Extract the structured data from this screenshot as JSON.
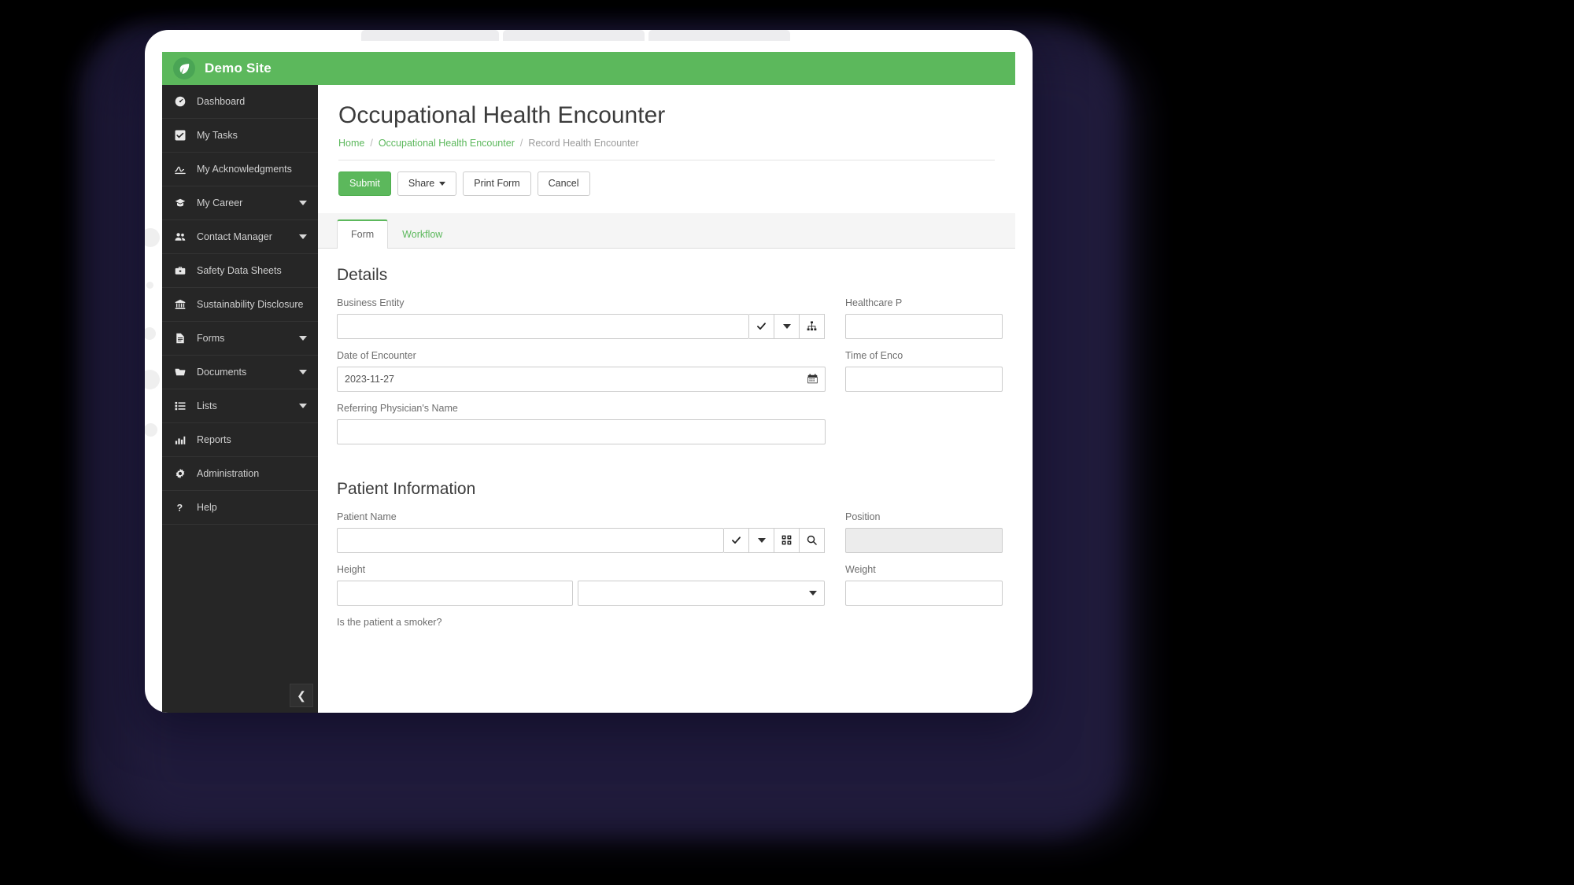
{
  "app": {
    "brand_title": "Demo Site",
    "logo_icon": "leaf-icon"
  },
  "sidebar": {
    "collapse_icon": "chevron-left-icon",
    "items": [
      {
        "label": "Dashboard",
        "icon": "dashboard-icon",
        "has_caret": false
      },
      {
        "label": "My Tasks",
        "icon": "check-square-icon",
        "has_caret": false
      },
      {
        "label": "My Acknowledgments",
        "icon": "signature-icon",
        "has_caret": false
      },
      {
        "label": "My Career",
        "icon": "graduation-icon",
        "has_caret": true
      },
      {
        "label": "Contact Manager",
        "icon": "users-icon",
        "has_caret": true
      },
      {
        "label": "Safety Data Sheets",
        "icon": "briefcase-icon",
        "has_caret": false
      },
      {
        "label": "Sustainability Disclosure",
        "icon": "bank-icon",
        "has_caret": false
      },
      {
        "label": "Forms",
        "icon": "file-icon",
        "has_caret": true
      },
      {
        "label": "Documents",
        "icon": "folder-icon",
        "has_caret": true
      },
      {
        "label": "Lists",
        "icon": "list-icon",
        "has_caret": true
      },
      {
        "label": "Reports",
        "icon": "chart-icon",
        "has_caret": false
      },
      {
        "label": "Administration",
        "icon": "gear-icon",
        "has_caret": false
      },
      {
        "label": "Help",
        "icon": "question-icon",
        "has_caret": false
      }
    ]
  },
  "header": {
    "page_title": "Occupational Health Encounter",
    "breadcrumb": {
      "home": "Home",
      "level2": "Occupational Health Encounter",
      "current": "Record Health Encounter",
      "separator": "/"
    }
  },
  "toolbar": {
    "submit_label": "Submit",
    "share_label": "Share",
    "print_label": "Print Form",
    "cancel_label": "Cancel"
  },
  "tabs": [
    {
      "label": "Form",
      "active": true
    },
    {
      "label": "Workflow",
      "active": false
    }
  ],
  "sections": {
    "details": {
      "title": "Details",
      "business_entity": {
        "label": "Business Entity",
        "value": "",
        "buttons": [
          "check-icon",
          "caret-down-icon",
          "sitemap-icon"
        ]
      },
      "healthcare_provider": {
        "label": "Healthcare P",
        "value": ""
      },
      "date_of_encounter": {
        "label": "Date of Encounter",
        "value": "2023-11-27",
        "icon": "calendar-icon"
      },
      "time_of_encounter": {
        "label": "Time of Enco",
        "value": ""
      },
      "referring_physician": {
        "label": "Referring Physician's Name",
        "value": ""
      }
    },
    "patient": {
      "title": "Patient Information",
      "patient_name": {
        "label": "Patient Name",
        "value": "",
        "buttons": [
          "check-icon",
          "caret-down-icon",
          "qrcode-icon",
          "search-icon"
        ]
      },
      "position": {
        "label": "Position",
        "value": "",
        "disabled": true
      },
      "height": {
        "label": "Height",
        "value": "",
        "unit_value": "",
        "unit_icon": "caret-down-icon"
      },
      "weight": {
        "label": "Weight",
        "value": ""
      },
      "smoker": {
        "label": "Is the patient a smoker?"
      }
    }
  },
  "colors": {
    "brand_green": "#5cb85c",
    "sidebar_dark": "#262626",
    "page_bg": "#ffffff",
    "tabstrip_bg": "#f5f5f5"
  }
}
